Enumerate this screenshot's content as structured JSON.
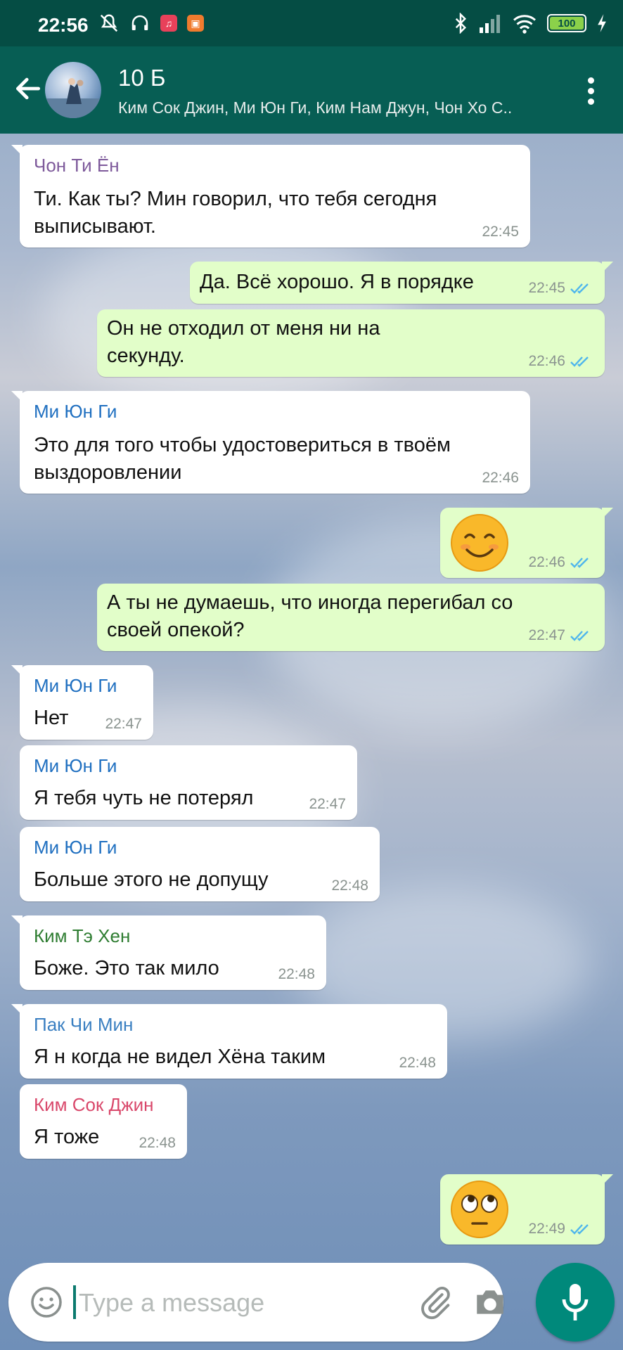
{
  "status_bar": {
    "time": "22:56",
    "battery": "100",
    "icons_left": [
      "mute-icon",
      "headphones-icon",
      "music-app-icon",
      "mi-app-icon"
    ],
    "icons_right": [
      "bluetooth-icon",
      "signal-icon",
      "wifi-icon",
      "battery-icon",
      "charging-icon"
    ]
  },
  "header": {
    "title": "10 Б",
    "subtitle": "Ким Сок Джин, Ми Юн Ги, Ким Нам Джун, Чон Хо С..",
    "icons": [
      "back-arrow-icon",
      "group-avatar",
      "more-vert-icon"
    ]
  },
  "colors": {
    "header": "#075e54",
    "status_bar": "#054d44",
    "outgoing_bubble": "#e2fec9",
    "incoming_bubble": "#ffffff",
    "tick_read": "#4fb6ec",
    "mic_button": "#00897b"
  },
  "messages": [
    {
      "dir": "in",
      "sender": "Чон Ти Ён",
      "sender_color": "#7e5a9b",
      "lines": [
        "Ти. Как ты? Мин говорил, что тебя сегодня",
        "выписывают."
      ],
      "time": "22:45"
    },
    {
      "dir": "out",
      "lines": [
        "Да. Всё хорошо. Я в порядке"
      ],
      "time": "22:45"
    },
    {
      "dir": "out",
      "lines": [
        "Он не отходил от меня ни на",
        "секунду."
      ],
      "time": "22:46"
    },
    {
      "dir": "in",
      "sender": "Ми Юн Ги",
      "sender_color": "#1f6fc0",
      "lines": [
        "Это для того чтобы удостовериться в твоём",
        "выздоровлении"
      ],
      "time": "22:46"
    },
    {
      "dir": "out",
      "emoji": "smiling-face-emoji",
      "time": "22:46"
    },
    {
      "dir": "out",
      "lines": [
        "А ты не думаешь, что иногда перегибал со",
        "своей опекой?"
      ],
      "time": "22:47"
    },
    {
      "dir": "in",
      "sender": "Ми Юн Ги",
      "sender_color": "#1f6fc0",
      "lines": [
        "Нет"
      ],
      "time": "22:47"
    },
    {
      "dir": "in",
      "sender": "Ми Юн Ги",
      "sender_color": "#1f6fc0",
      "lines": [
        "Я тебя чуть не потерял"
      ],
      "time": "22:47"
    },
    {
      "dir": "in",
      "sender": "Ми Юн Ги",
      "sender_color": "#1f6fc0",
      "lines": [
        "Больше этого не допущу"
      ],
      "time": "22:48"
    },
    {
      "dir": "in",
      "sender": "Ким Тэ Хен",
      "sender_color": "#2f7d32",
      "lines": [
        "Боже. Это так мило"
      ],
      "time": "22:48"
    },
    {
      "dir": "in",
      "sender": "Пак Чи Мин",
      "sender_color": "#3a7fc1",
      "lines": [
        "Я н когда не видел Хёна таким"
      ],
      "time": "22:48"
    },
    {
      "dir": "in",
      "sender": "Ким Сок Джин",
      "sender_color": "#d9486b",
      "lines": [
        "Я тоже"
      ],
      "time": "22:48"
    },
    {
      "dir": "out",
      "emoji": "eye-roll-emoji",
      "time": "22:49"
    }
  ],
  "input": {
    "placeholder": "Type a message",
    "icons": [
      "emoji-icon",
      "attach-icon",
      "camera-icon",
      "mic-icon"
    ]
  }
}
